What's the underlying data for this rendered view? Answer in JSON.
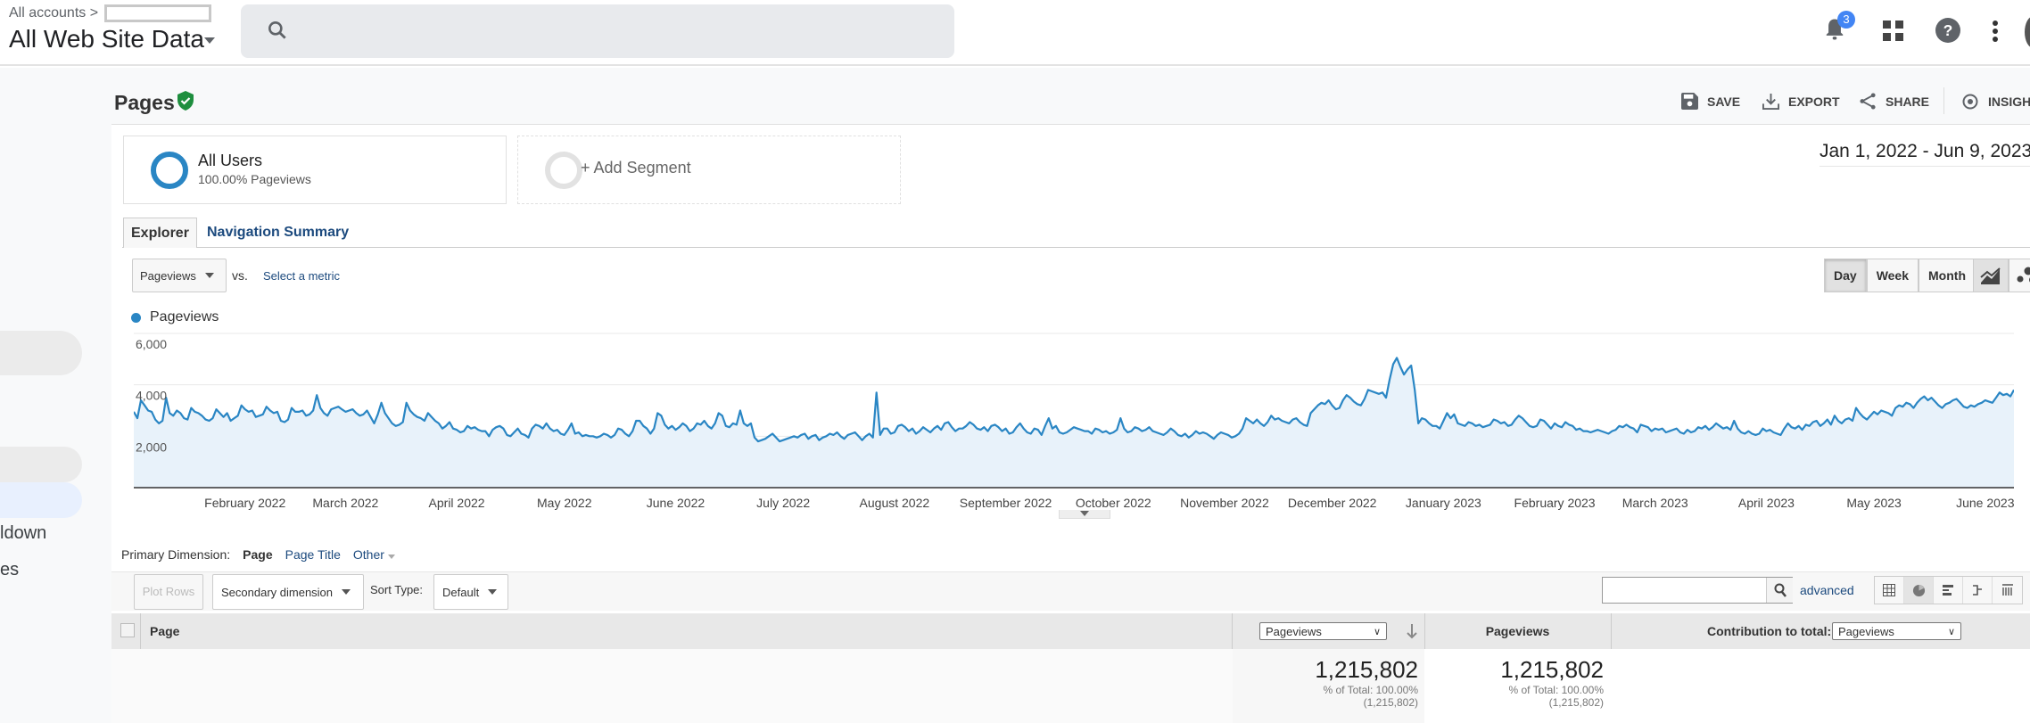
{
  "topbar": {
    "breadcrumb": "All accounts",
    "view_name": "All Web Site Data",
    "notifications_count": "3",
    "icons": [
      "search-icon",
      "bell-icon",
      "apps-grid-icon",
      "help-icon",
      "more-vert-icon"
    ]
  },
  "sidebar": {
    "items": [
      "ldown",
      "es"
    ]
  },
  "header": {
    "title": "Pages",
    "verified": "check-shield-icon",
    "actions": [
      {
        "label": "SAVE",
        "icon": "save-icon"
      },
      {
        "label": "EXPORT",
        "icon": "download-icon"
      },
      {
        "label": "SHARE",
        "icon": "share-icon"
      },
      {
        "label": "INSIGHT",
        "icon": "insights-icon"
      }
    ]
  },
  "segments": [
    {
      "name": "All Users",
      "detail": "100.00% Pageviews"
    },
    {
      "name": "+ Add Segment"
    }
  ],
  "date_range": "Jan 1, 2022 - Jun 9, 2023",
  "tabs": [
    {
      "label": "Explorer",
      "active": true
    },
    {
      "label": "Navigation Summary"
    }
  ],
  "metric": {
    "selected": "Pageviews",
    "vs": "vs.",
    "select_metric": "Select a metric"
  },
  "period": {
    "options": [
      "Day",
      "Week",
      "Month"
    ],
    "selected": "Day"
  },
  "colors": {
    "series": "#2a86c4",
    "fill": "#e8f2fa",
    "link": "#1c4a7e"
  },
  "chart_data": {
    "type": "area",
    "legend": [
      "Pageviews"
    ],
    "x_start": "2022-01-01",
    "x_end": "2023-06-09",
    "x_unit": "day",
    "ylim": [
      0,
      6000
    ],
    "y_ticks": [
      "6,000",
      "4,000",
      "2,000"
    ],
    "y_tick_values": [
      6000,
      4000,
      2000
    ],
    "grid": true,
    "x_ticks": [
      {
        "label": "February 2022",
        "date": "2022-02-01"
      },
      {
        "label": "March 2022",
        "date": "2022-03-01"
      },
      {
        "label": "April 2022",
        "date": "2022-04-01"
      },
      {
        "label": "May 2022",
        "date": "2022-05-01"
      },
      {
        "label": "June 2022",
        "date": "2022-06-01"
      },
      {
        "label": "July 2022",
        "date": "2022-07-01"
      },
      {
        "label": "August 2022",
        "date": "2022-08-01"
      },
      {
        "label": "September 2022",
        "date": "2022-09-01"
      },
      {
        "label": "October 2022",
        "date": "2022-10-01"
      },
      {
        "label": "November 2022",
        "date": "2022-11-01"
      },
      {
        "label": "December 2022",
        "date": "2022-12-01"
      },
      {
        "label": "January 2023",
        "date": "2023-01-01"
      },
      {
        "label": "February 2023",
        "date": "2023-02-01"
      },
      {
        "label": "March 2023",
        "date": "2023-03-01"
      },
      {
        "label": "April 2023",
        "date": "2023-04-01"
      },
      {
        "label": "May 2023",
        "date": "2023-05-01"
      },
      {
        "label": "June 2023",
        "date": "2023-06-01"
      }
    ],
    "values": [
      2950,
      2700,
      3400,
      3200,
      3000,
      2950,
      2650,
      2500,
      2600,
      3500,
      2900,
      2800,
      3000,
      2900,
      2700,
      2650,
      3100,
      2950,
      2900,
      2800,
      2650,
      2600,
      2700,
      3050,
      2900,
      2750,
      2900,
      2600,
      2700,
      2800,
      3200,
      3050,
      2950,
      3000,
      2750,
      2800,
      2850,
      3150,
      3000,
      2900,
      2950,
      2600,
      2550,
      2650,
      3100,
      2950,
      2950,
      3000,
      2800,
      2850,
      3000,
      3600,
      3100,
      2900,
      2800,
      3050,
      3100,
      3150,
      3050,
      2950,
      3000,
      3050,
      2900,
      2800,
      2850,
      3000,
      2750,
      2500,
      2850,
      3300,
      2900,
      2700,
      2500,
      2400,
      2450,
      2550,
      3300,
      3000,
      2850,
      2750,
      2700,
      2600,
      2900,
      2750,
      2600,
      2500,
      2300,
      2400,
      2550,
      2300,
      2250,
      2150,
      2200,
      2400,
      2300,
      2350,
      2250,
      2200,
      2200,
      2000,
      2250,
      2350,
      2400,
      2300,
      2050,
      2000,
      2150,
      2300,
      2100,
      2050,
      1950,
      2300,
      2450,
      2400,
      2300,
      2500,
      2300,
      2200,
      2250,
      2100,
      2050,
      2250,
      2500,
      2100,
      2150,
      2000,
      2050,
      2000,
      2000,
      1950,
      2000,
      2100,
      2050,
      1950,
      2050,
      2300,
      2250,
      2100,
      2000,
      2200,
      2600,
      2600,
      2400,
      2300,
      2100,
      2300,
      2900,
      2800,
      2450,
      2300,
      2400,
      2250,
      2350,
      2500,
      2400,
      2200,
      2300,
      2500,
      2450,
      2600,
      2400,
      2300,
      2500,
      2900,
      2800,
      2400,
      2350,
      2500,
      2450,
      3000,
      2500,
      2400,
      2500,
      1950,
      1800,
      1850,
      1900,
      2000,
      2100,
      1950,
      1800,
      1850,
      1900,
      1950,
      2000,
      1950,
      2050,
      2100,
      1900,
      2000,
      2050,
      1850,
      1950,
      2000,
      2100,
      2050,
      2150,
      2000,
      1900,
      2050,
      2100,
      2150,
      2000,
      1850,
      2000,
      2100,
      1950,
      3700,
      2050,
      2300,
      2300,
      2100,
      2150,
      2400,
      2450,
      2350,
      2200,
      2300,
      2100,
      2200,
      2350,
      2250,
      2150,
      2300,
      2400,
      2250,
      2500,
      2550,
      2350,
      2200,
      2300,
      2300,
      2400,
      2550,
      2450,
      2300,
      2250,
      2350,
      2200,
      2400,
      2450,
      2350,
      2200,
      2300,
      2100,
      2150,
      2350,
      2500,
      2300,
      2150,
      2100,
      2300,
      2250,
      2050,
      2400,
      2700,
      2300,
      2400,
      2150,
      2100,
      2150,
      2250,
      2350,
      2300,
      2250,
      2200,
      2200,
      2100,
      2300,
      2250,
      2150,
      2200,
      2100,
      2150,
      2250,
      2700,
      2300,
      2150,
      2200,
      2350,
      2300,
      2200,
      2250,
      2350,
      2200,
      2150,
      2100,
      2050,
      2150,
      2300,
      2200,
      2050,
      2000,
      2100,
      1950,
      2050,
      2200,
      2100,
      2150,
      2100,
      2000,
      1900,
      2050,
      2150,
      2100,
      2050,
      1950,
      2000,
      2100,
      2300,
      2700,
      2600,
      2500,
      2650,
      2500,
      2400,
      2550,
      2800,
      2650,
      2700,
      2600,
      2550,
      2500,
      2650,
      2700,
      2550,
      2450,
      2400,
      2900,
      3050,
      3200,
      3300,
      3250,
      3400,
      3200,
      3050,
      3100,
      3400,
      3600,
      3500,
      3350,
      3250,
      3200,
      3450,
      3800,
      3750,
      3700,
      3650,
      3700,
      3500,
      4200,
      4800,
      5050,
      4700,
      4400,
      4600,
      4750,
      3800,
      2500,
      2700,
      2650,
      2500,
      2400,
      2400,
      2300,
      2600,
      2900,
      2700,
      2850,
      2500,
      2450,
      2400,
      2550,
      2500,
      2400,
      2450,
      2350,
      2400,
      2450,
      2650,
      2600,
      2500,
      2550,
      2400,
      2450,
      2650,
      2800,
      2700,
      2550,
      2400,
      2350,
      2400,
      2650,
      2600,
      2450,
      2300,
      2500,
      2400,
      2350,
      2550,
      2450,
      2400,
      2250,
      2300,
      2200,
      2200,
      2150,
      2200,
      2250,
      2200,
      2150,
      2100,
      2200,
      2250,
      2400,
      2350,
      2450,
      2350,
      2300,
      2150,
      2450,
      2400,
      2350,
      2200,
      2300,
      2250,
      2300,
      2150,
      2200,
      2250,
      2300,
      2150,
      2100,
      2250,
      2150,
      2200,
      2350,
      2300,
      2400,
      2250,
      2350,
      2500,
      2400,
      2300,
      2350,
      2250,
      2600,
      2300,
      2150,
      2100,
      2200,
      2100,
      2050,
      2100,
      2300,
      2200,
      2250,
      2150,
      2100,
      2050,
      2300,
      2500,
      2350,
      2300,
      2400,
      2250,
      2450,
      2400,
      2550,
      2600,
      2400,
      2500,
      2650,
      2450,
      2800,
      2600,
      2500,
      2650,
      2700,
      2600,
      3100,
      2900,
      2750,
      2650,
      2800,
      2950,
      2850,
      3000,
      2950,
      2900,
      2800,
      3100,
      3200,
      3150,
      3300,
      3250,
      3100,
      3300,
      3450,
      3550,
      3400,
      3500,
      3350,
      3200,
      3100,
      3250,
      3300,
      3400,
      3450,
      3300,
      3150,
      3100,
      3200,
      3150,
      3250,
      3300,
      3400,
      3350,
      3300,
      3500,
      3700,
      3600,
      3650,
      3550,
      3800
    ]
  },
  "dimension": {
    "label": "Primary Dimension:",
    "options": [
      "Page",
      "Page Title",
      "Other"
    ],
    "selected": "Page"
  },
  "toolbar": {
    "plot_rows": "Plot Rows",
    "secondary": "Secondary dimension",
    "sort_label": "Sort Type:",
    "sort_value": "Default",
    "search_value": "",
    "advanced": "advanced",
    "view_icons": [
      "table-view-icon",
      "pie-view-icon",
      "bar-view-icon",
      "comparison-view-icon",
      "pivot-view-icon"
    ],
    "selected_view": "pie-view-icon"
  },
  "table": {
    "col_page": "Page",
    "col_metric_select": "Pageviews",
    "col_pageviews": "Pageviews",
    "contribution_label": "Contribution to total:",
    "contribution_select": "Pageviews",
    "totals": [
      {
        "value": "1,215,802",
        "pct": "% of Total: 100.00%",
        "total": "(1,215,802)"
      },
      {
        "value": "1,215,802",
        "pct": "% of Total: 100.00%",
        "total": "(1,215,802)"
      }
    ]
  }
}
